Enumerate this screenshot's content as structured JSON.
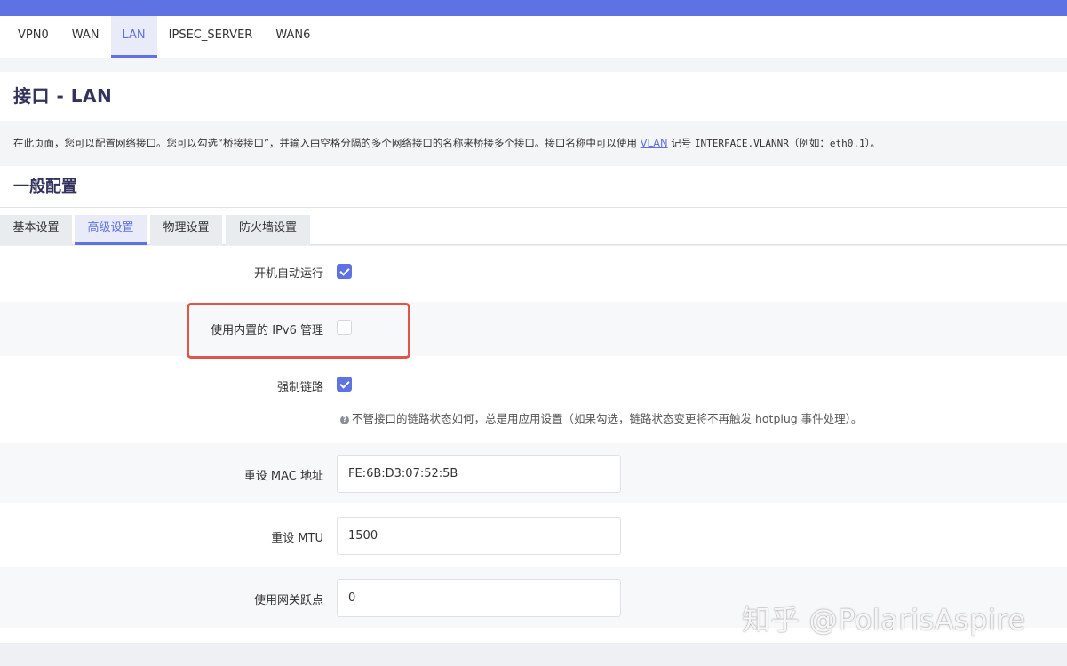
{
  "interface_tabs": [
    "VPN0",
    "WAN",
    "LAN",
    "IPSEC_SERVER",
    "WAN6"
  ],
  "active_interface_tab": "LAN",
  "page_title": "接口 - LAN",
  "description": {
    "part1": "在此页面，您可以配置网络接口。您可以勾选“桥接接口”，并输入由空格分隔的多个网络接口的名称来桥接多个接口。接口名称中可以使用 ",
    "vlan_link": "VLAN",
    "part2": " 记号 ",
    "code1": "INTERFACE.VLANNR",
    "part3": "（例如：",
    "code2": "eth0.1",
    "part4": "）。"
  },
  "section_title": "一般配置",
  "sub_tabs": [
    "基本设置",
    "高级设置",
    "物理设置",
    "防火墙设置"
  ],
  "active_sub_tab": "高级设置",
  "fields": {
    "auto_start": {
      "label": "开机自动运行",
      "checked": true
    },
    "builtin_ipv6": {
      "label": "使用内置的 IPv6 管理",
      "checked": false
    },
    "force_link": {
      "label": "强制链路",
      "checked": true,
      "hint": "不管接口的链路状态如何，总是用应用设置（如果勾选，链路状态变更将不再触发 hotplug 事件处理）。"
    },
    "mac_override": {
      "label": "重设 MAC 地址",
      "value": "FE:6B:D3:07:52:5B"
    },
    "mtu_override": {
      "label": "重设 MTU",
      "value": "1500"
    },
    "gateway_metric": {
      "label": "使用网关跃点",
      "value": "0"
    }
  },
  "watermark": "知乎 @PolarisAspire",
  "colors": {
    "accent": "#5e72e4",
    "highlight_border": "#e05548"
  },
  "icons": {
    "hint": "question-circle-icon",
    "checkbox_checked": "checkmark-icon"
  }
}
